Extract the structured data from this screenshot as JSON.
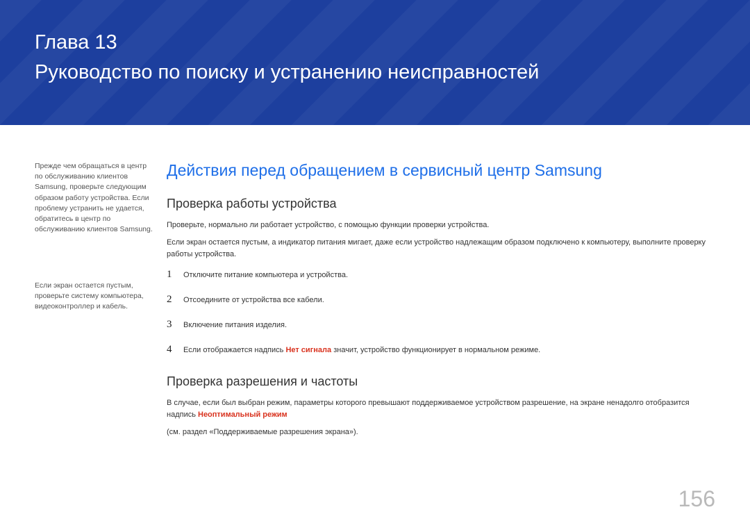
{
  "header": {
    "chapter_label": "Глава 13",
    "chapter_title": "Руководство по поиску и устранению неисправностей"
  },
  "sidebar": {
    "note1": "Прежде чем обращаться в центр по обслуживанию клиентов Samsung, проверьте следующим образом работу устройства. Если проблему устранить не удается, обратитесь в центр по обслуживанию клиентов Samsung.",
    "note2": "Если экран остается пустым, проверьте систему компьютера, видеоконтроллер и кабель."
  },
  "main": {
    "h1": "Действия перед обращением в сервисный центр Samsung",
    "section1": {
      "h2": "Проверка работы устройства",
      "p1": "Проверьте, нормально ли работает устройство, с помощью функции проверки устройства.",
      "p2": "Если экран остается пустым, а индикатор питания мигает, даже если устройство надлежащим образом подключено к компьютеру, выполните проверку работы устройства.",
      "steps": [
        "Отключите питание компьютера и устройства.",
        "Отсоедините от устройства все кабели.",
        "Включение питания изделия."
      ],
      "step4_pre": "Если отображается надпись ",
      "step4_red": "Нет сигнала",
      "step4_post": " значит, устройство функционирует в нормальном режиме."
    },
    "section2": {
      "h2": "Проверка разрешения и частоты",
      "p1_pre": "В случае, если был выбран режим, параметры которого превышают поддерживаемое устройством разрешение, на экране ненадолго отобразится надпись ",
      "p1_red": "Неоптимальный режим",
      "p2": "(см. раздел «Поддерживаемые разрешения экрана»)."
    }
  },
  "page_number": "156"
}
